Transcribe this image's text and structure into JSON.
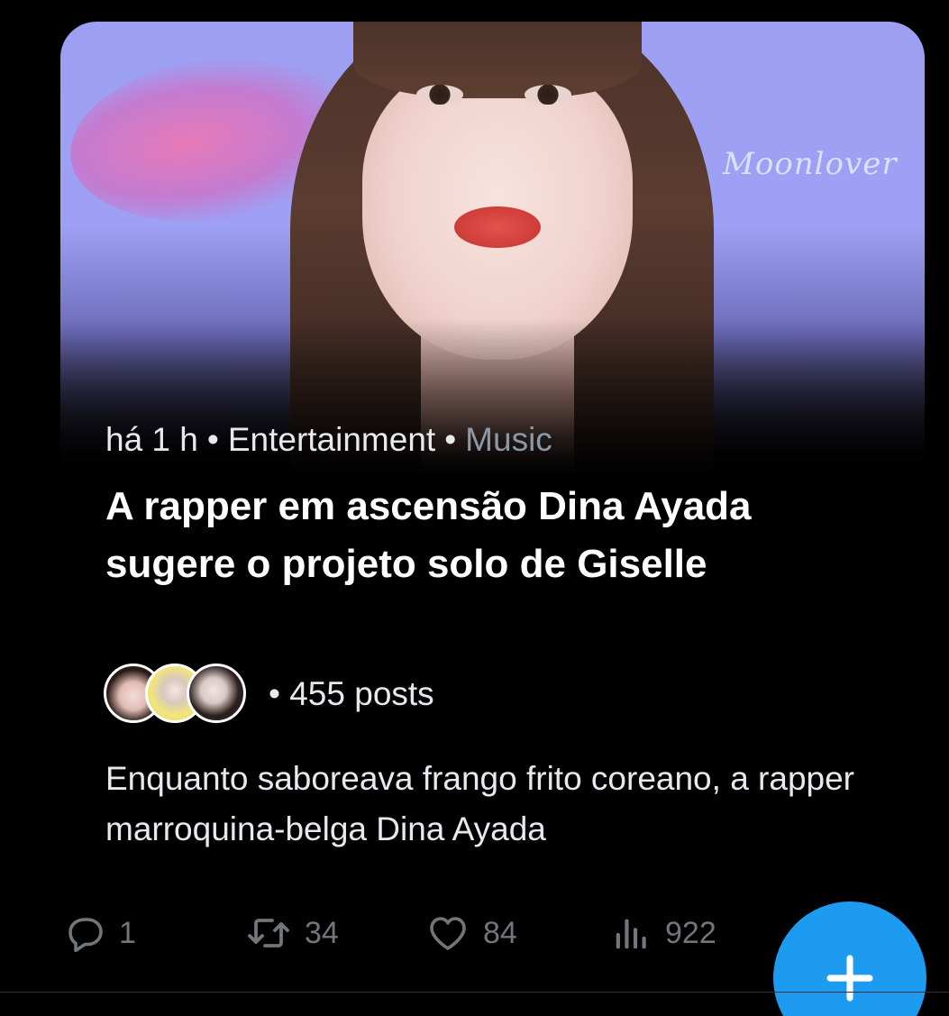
{
  "card": {
    "time": "há 1 h",
    "category": "Entertainment",
    "subcategory": "Music",
    "separator": "•",
    "headline": "A rapper em ascensão Dina Ayada sugere o projeto solo de Giselle",
    "post_count": "• 455 posts",
    "description": "Enquanto saboreava frango frito coreano, a rapper marroquina-belga Dina Ayada",
    "image_watermark": "Moonlover"
  },
  "actions": {
    "reply_count": "1",
    "retweet_count": "34",
    "like_count": "84",
    "views_count": "922"
  },
  "icons": {
    "reply": "reply-icon",
    "retweet": "retweet-icon",
    "like": "heart-icon",
    "views": "views-icon",
    "share": "share-icon",
    "compose": "plus-icon"
  },
  "colors": {
    "background": "#000000",
    "accent": "#1d9bf0",
    "muted": "#71767b",
    "category_muted": "#8b98a5"
  }
}
